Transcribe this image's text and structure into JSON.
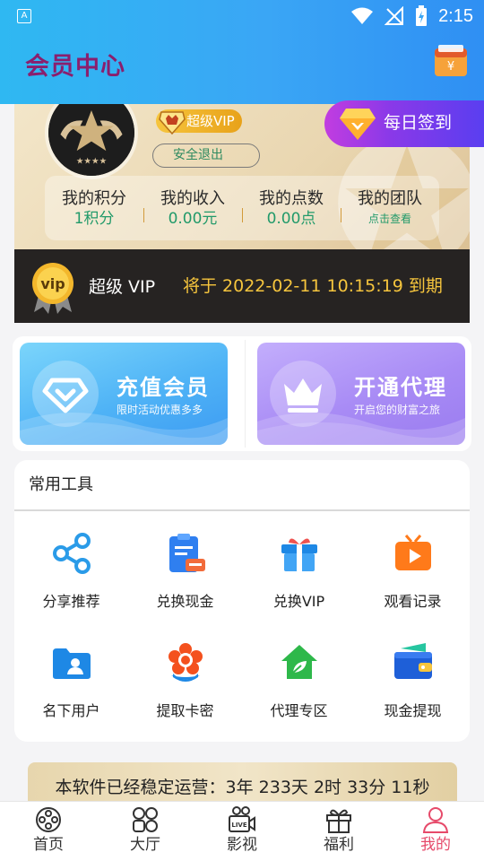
{
  "status_bar": {
    "notification_icon": "A",
    "time": "2:15"
  },
  "header": {
    "title": "会员中心",
    "wallet_icon": "wallet-icon"
  },
  "profile": {
    "vip_badge": "超级VIP",
    "logout_label": "安全退出",
    "checkin_label": "每日签到",
    "stats": [
      {
        "label": "我的积分",
        "value": "1积分"
      },
      {
        "label": "我的收入",
        "value": "0.00元"
      },
      {
        "label": "我的点数",
        "value": "0.00点"
      },
      {
        "label": "我的团队",
        "value": "点击查看"
      }
    ]
  },
  "vip_bar": {
    "level": "超级 VIP",
    "expire_text": "将于 2022-02-11 10:15:19 到期",
    "medal_text": "vip"
  },
  "promos": [
    {
      "title": "充值会员",
      "subtitle": "限时活动优惠多多",
      "color": "#4fb3f6"
    },
    {
      "title": "开通代理",
      "subtitle": "开启您的财富之旅",
      "color": "#a88bf5"
    }
  ],
  "tools": {
    "title": "常用工具",
    "items": [
      {
        "label": "分享推荐",
        "icon": "share-icon"
      },
      {
        "label": "兑换现金",
        "icon": "exchange-cash-icon"
      },
      {
        "label": "兑换VIP",
        "icon": "gift-box-icon"
      },
      {
        "label": "观看记录",
        "icon": "tv-play-icon"
      },
      {
        "label": "名下用户",
        "icon": "user-folder-icon"
      },
      {
        "label": "提取卡密",
        "icon": "flower-icon"
      },
      {
        "label": "代理专区",
        "icon": "house-leaf-icon"
      },
      {
        "label": "现金提现",
        "icon": "wallet-icon"
      }
    ]
  },
  "runtime": {
    "text": "本软件已经稳定运营：3年 233天 2时 33分 11秒"
  },
  "nav": {
    "items": [
      {
        "label": "首页",
        "icon": "film-reel-icon"
      },
      {
        "label": "大厅",
        "icon": "grid-icon"
      },
      {
        "label": "影视",
        "icon": "live-camera-icon"
      },
      {
        "label": "福利",
        "icon": "gift-icon"
      },
      {
        "label": "我的",
        "icon": "person-icon"
      }
    ],
    "active_index": 4,
    "active_color": "#e64a6a"
  },
  "colors": {
    "header": "#3aa6f5",
    "title": "#8a1f6e",
    "accent_green": "#229a6a",
    "gold": "#f6c53d"
  }
}
